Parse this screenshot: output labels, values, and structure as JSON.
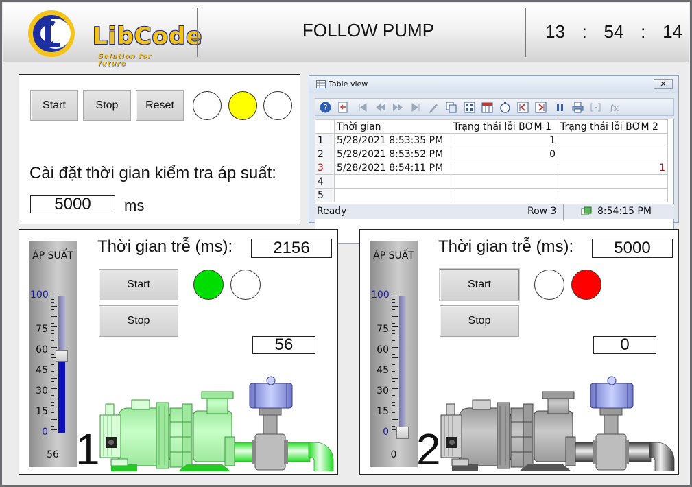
{
  "header": {
    "logo_text": "LibCode",
    "logo_tagline": "Solution for future",
    "title": "FOLLOW PUMP",
    "clock": {
      "hh": "13",
      "mm": "54",
      "ss": "14",
      "sep": ":"
    }
  },
  "control": {
    "start_label": "Start",
    "stop_label": "Stop",
    "reset_label": "Reset",
    "lamps": [
      "#ffffff",
      "#ffff00",
      "#ffffff"
    ],
    "pressure_time_label": "Cài đặt thời gian kiểm tra áp suất:",
    "pressure_time_value": "5000",
    "pressure_time_unit": "ms"
  },
  "table_view": {
    "title": "Table view",
    "columns": [
      "Thời gian",
      "Trạng thái lỗi BƠM 1",
      "Trạng thái lỗi BƠM 2"
    ],
    "rows": [
      {
        "num": "1",
        "time": "5/28/2021 8:53:35 PM",
        "b1": "1",
        "b2": ""
      },
      {
        "num": "2",
        "time": "5/28/2021 8:53:52 PM",
        "b1": "0",
        "b2": ""
      },
      {
        "num": "3",
        "time": "5/28/2021 8:54:11 PM",
        "b1": "",
        "b2": "1"
      },
      {
        "num": "4",
        "time": "",
        "b1": "",
        "b2": ""
      },
      {
        "num": "5",
        "time": "",
        "b1": "",
        "b2": ""
      }
    ],
    "status": "Ready",
    "row_info": "Row 3",
    "status_time": "8:54:15 PM"
  },
  "pumps": [
    {
      "number": "1",
      "gauge_label": "ÁP SUẤT",
      "gauge_value": "56",
      "pressure_level": 56,
      "delay_label": "Thời gian trễ (ms):",
      "delay_value": "2156",
      "start_label": "Start",
      "stop_label": "Stop",
      "lamps": [
        "#00dd00",
        "#ffffff"
      ],
      "sensor_value": "56",
      "running": true
    },
    {
      "number": "2",
      "gauge_label": "ÁP SUẤT",
      "gauge_value": "0",
      "pressure_level": 0,
      "delay_label": "Thời gian trễ (ms):",
      "delay_value": "5000",
      "start_label": "Start",
      "stop_label": "Stop",
      "lamps": [
        "#ffffff",
        "#ff0000"
      ],
      "sensor_value": "0",
      "running": false
    }
  ],
  "gauge_ticks": [
    "100",
    "75",
    "60",
    "45",
    "30",
    "15",
    "0"
  ],
  "colors": {
    "accent_blue": "#1010b8",
    "alarm_red": "#ff0000",
    "ok_green": "#00dd00"
  }
}
